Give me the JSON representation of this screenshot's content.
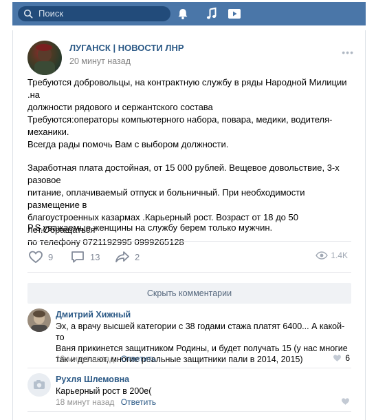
{
  "topbar": {
    "search_placeholder": "Поиск",
    "icons": [
      "search-icon",
      "bell-icon",
      "music-icon",
      "play-icon"
    ],
    "color": "#4a76a8"
  },
  "post": {
    "author": "ЛУГАНСК | НОВОСТИ ЛНР",
    "time": "20 минут назад",
    "more": "•••",
    "paragraphs": [
      [
        "Требуются добровольцы, на контрактную службу в ряды Народной Милиции .на",
        "должности рядового и сержантского состава"
      ],
      [
        "Требуются:операторы компьютерного набора, повара, медики, водителя-",
        "механики.",
        "Всегда рады помочь Вам с выбором должности."
      ],
      [
        "Заработная плата достойная, от 15 000 рублей. Вещевое довольствие, 3-х разовое",
        "питание, оплачиваемый отпуск и больничный. При необходимости размещение в",
        "благоустроенных казармах .Карьерный рост. Возраст от 18 до 50 лет.Обращаться",
        "по телефону 0721192995 0999265128"
      ],
      [
        "P.S.уважаемые женщины на службу берем только мужчин."
      ]
    ],
    "likes": "9",
    "comments": "13",
    "shares": "2",
    "views": "1.4K"
  },
  "hide_comments_label": "Скрыть комментарии",
  "comments": [
    {
      "author": "Дмитрий Хижный",
      "lines": [
        "Эх, а врачу высшей категории с 38 годами стажа платят 6400... А какой-то",
        "Ваня прикинется защитником Родины, и будет получать 15 (у нас многие",
        "так и делают, многие реальные защитники пали в 2014, 2015)"
      ],
      "time": "18 минут назад",
      "reply": "Ответить",
      "likes": "6"
    },
    {
      "author": "Рухля Шлемовна",
      "lines": [
        "Карьерный рост в 200е("
      ],
      "time": "18 минут назад",
      "reply": "Ответить",
      "likes": ""
    }
  ]
}
